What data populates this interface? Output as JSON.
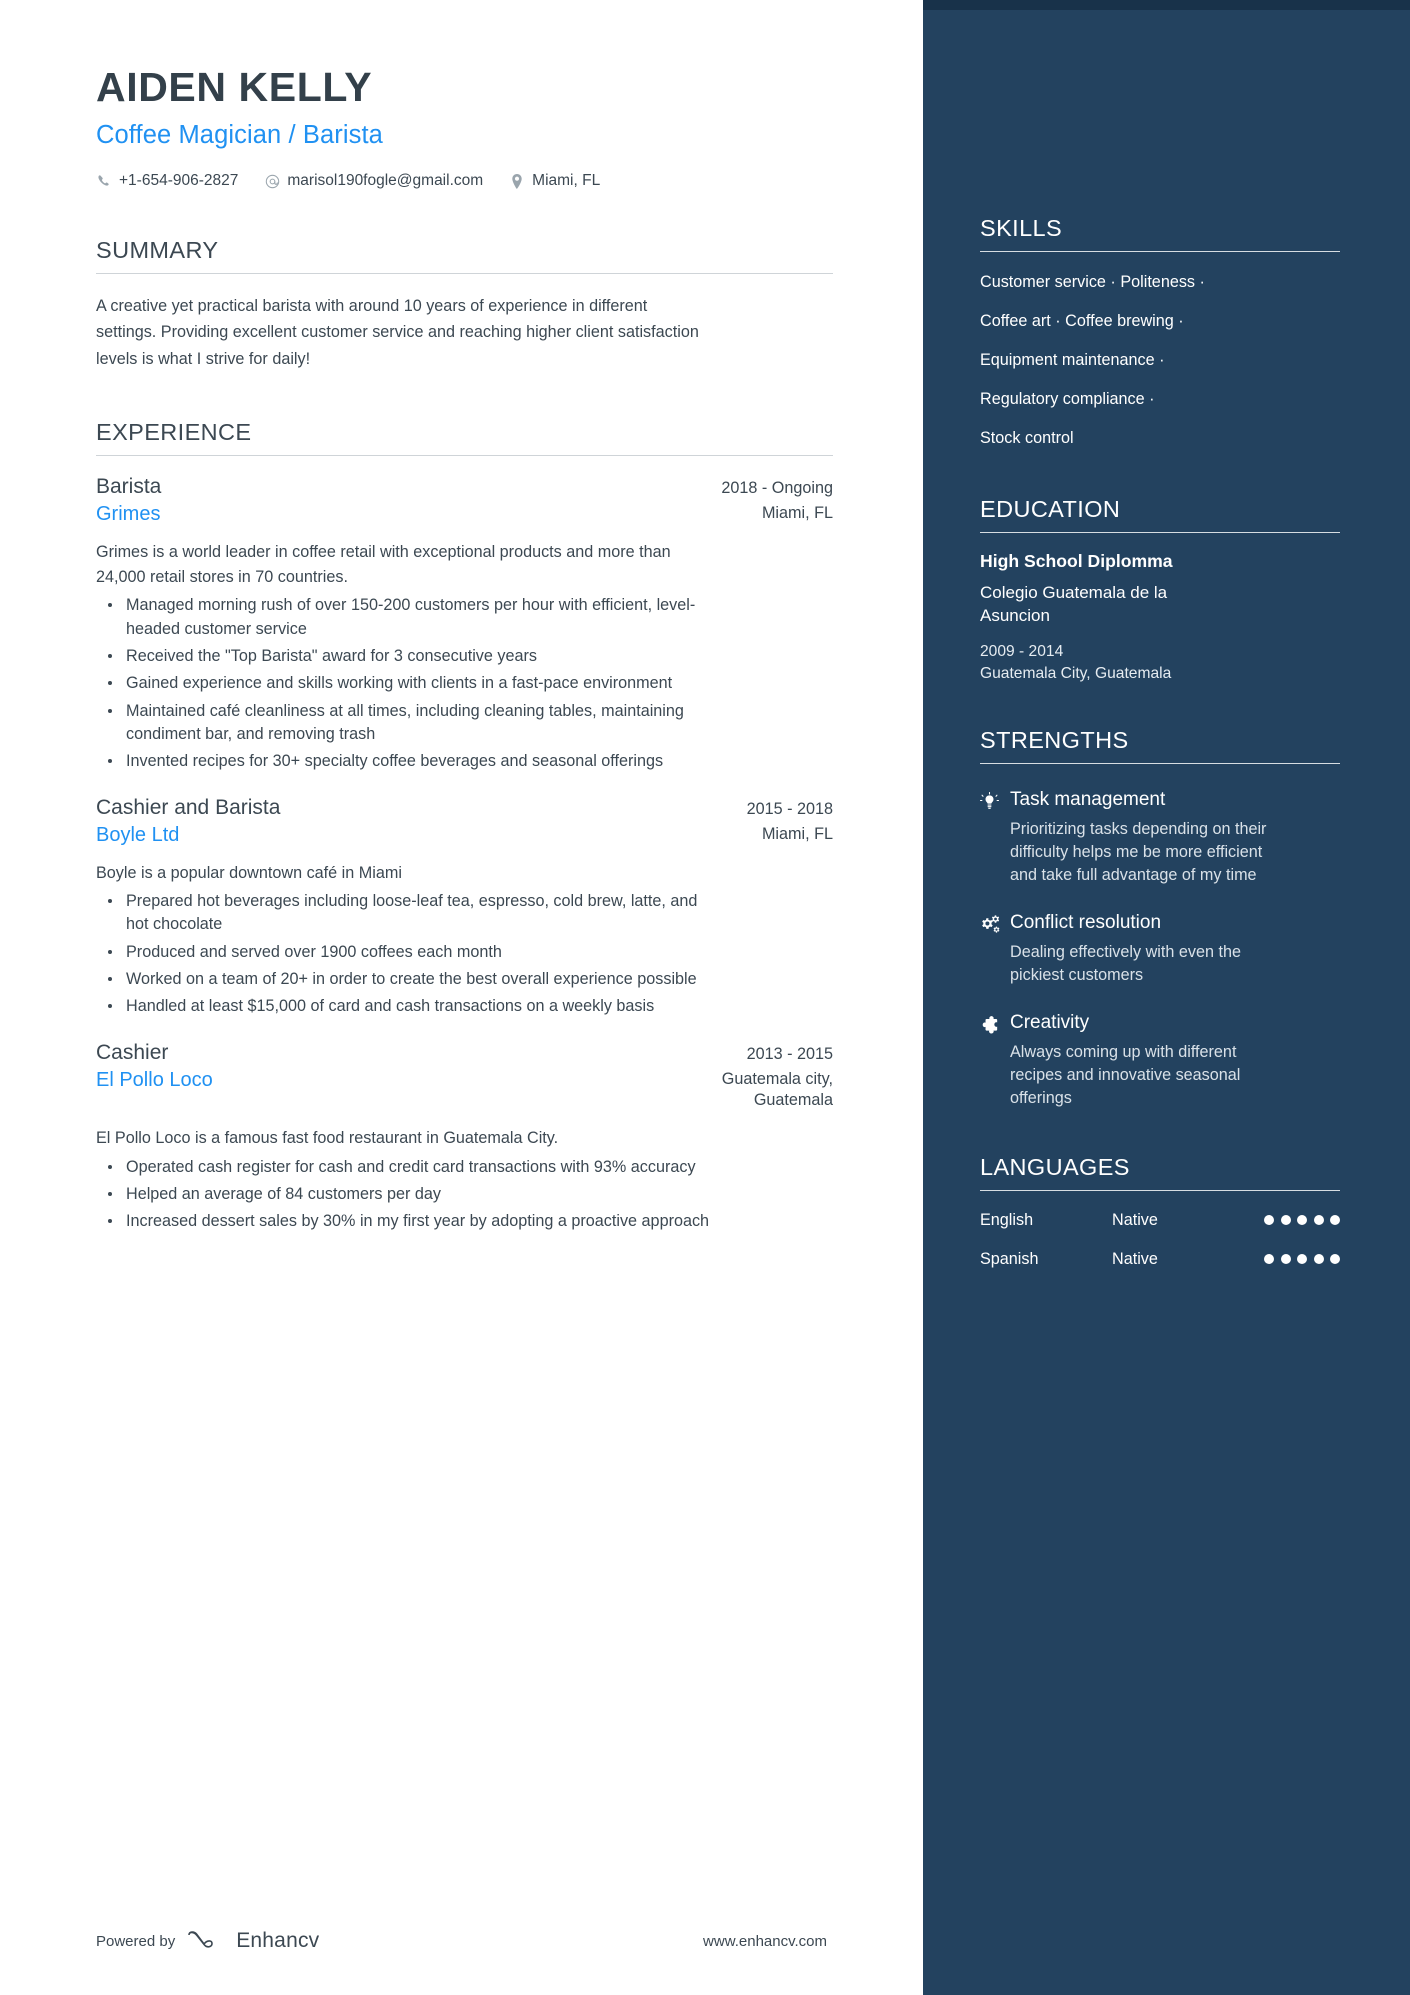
{
  "header": {
    "name": "AIDEN KELLY",
    "headline": "Coffee Magician / Barista",
    "phone": "+1-654-906-2827",
    "email": "marisol190fogle@gmail.com",
    "location": "Miami, FL"
  },
  "summary": {
    "title": "SUMMARY",
    "text": "A creative yet practical barista with around 10 years of experience in different settings. Providing excellent customer service and reaching higher client satisfaction levels is what I strive for daily!"
  },
  "experience": {
    "title": "EXPERIENCE",
    "jobs": [
      {
        "title": "Barista",
        "dates": "2018 - Ongoing",
        "company": "Grimes",
        "location": "Miami, FL",
        "description": "Grimes is a world leader in coffee retail with exceptional products and more than 24,000 retail stores in 70 countries.",
        "bullets": [
          "Managed morning rush of over 150-200 customers per hour with efficient, level-headed customer service",
          "Received the \"Top Barista\" award for 3 consecutive years",
          "Gained experience and skills working with clients in a fast-pace environment",
          "Maintained café cleanliness at all times, including cleaning tables, maintaining condiment bar, and removing trash",
          "Invented recipes for 30+ specialty coffee beverages and seasonal offerings"
        ]
      },
      {
        "title": "Cashier and Barista",
        "dates": "2015 - 2018",
        "company": "Boyle Ltd",
        "location": "Miami, FL",
        "description": "Boyle is a popular downtown café in Miami",
        "bullets": [
          "Prepared hot beverages including loose-leaf tea, espresso, cold brew, latte, and hot chocolate",
          "Produced and served over 1900 coffees each month",
          "Worked on a team of 20+ in order to create the best overall experience possible",
          "Handled at least $15,000 of card and cash transactions on a weekly basis"
        ]
      },
      {
        "title": "Cashier",
        "dates": "2013 - 2015",
        "company": "El Pollo Loco",
        "location": "Guatemala city, Guatemala",
        "description": "El Pollo Loco is a famous fast food restaurant in Guatemala City.",
        "bullets": [
          "Operated cash register for cash and credit card transactions with 93% accuracy",
          "Helped an average of 84 customers per day",
          "Increased dessert sales by 30% in my first year by adopting a proactive approach"
        ]
      }
    ]
  },
  "skills": {
    "title": "SKILLS",
    "lines": [
      "Customer service · Politeness ·",
      "Coffee art · Coffee brewing ·",
      "Equipment maintenance ·",
      "Regulatory compliance ·",
      "Stock control"
    ]
  },
  "education": {
    "title": "EDUCATION",
    "entries": [
      {
        "degree": "High School Diplomma",
        "school": "Colegio Guatemala de la Asuncion",
        "dates": "2009 - 2014",
        "location": "Guatemala City, Guatemala"
      }
    ]
  },
  "strengths": {
    "title": "STRENGTHS",
    "items": [
      {
        "icon": "lightbulb-icon",
        "name": "Task management",
        "description": "Prioritizing tasks depending on their difficulty helps me be more efficient and take full advantage of my time"
      },
      {
        "icon": "gears-icon",
        "name": "Conflict resolution",
        "description": "Dealing effectively with even the pickiest customers"
      },
      {
        "icon": "puzzle-icon",
        "name": "Creativity",
        "description": "Always coming up with different recipes and innovative seasonal offerings"
      }
    ]
  },
  "languages": {
    "title": "LANGUAGES",
    "items": [
      {
        "name": "English",
        "level": "Native",
        "filled": 5,
        "total": 5
      },
      {
        "name": "Spanish",
        "level": "Native",
        "filled": 5,
        "total": 5
      }
    ]
  },
  "footer": {
    "powered_by": "Powered by",
    "brand": "Enhancv",
    "website": "www.enhancv.com"
  },
  "colors": {
    "accent_blue": "#2091f2",
    "sidebar_bg": "#23425f",
    "text_dark": "#3c4852"
  }
}
